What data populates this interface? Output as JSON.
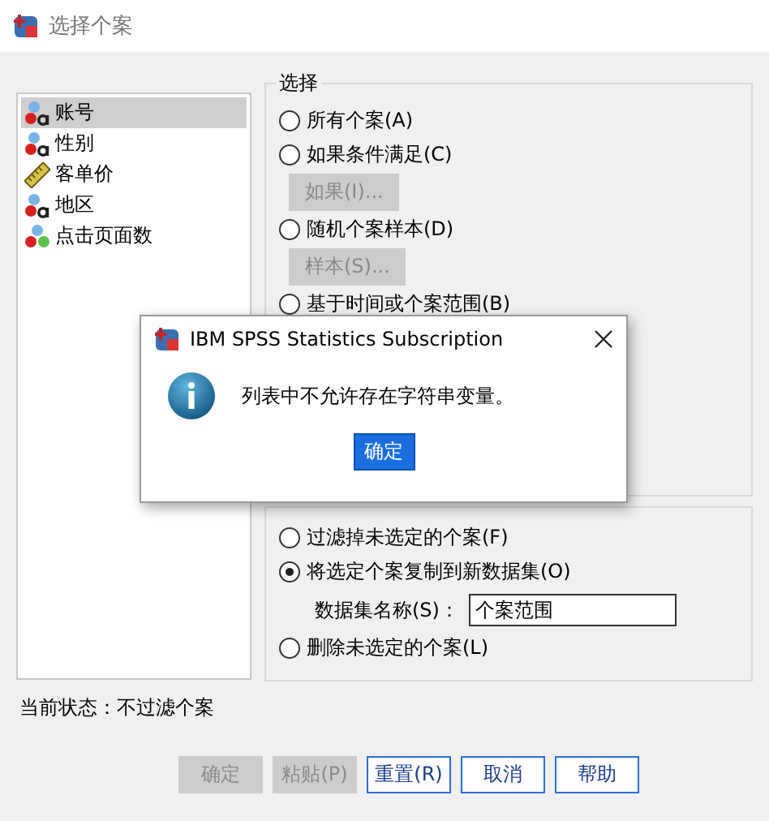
{
  "window": {
    "title": "选择个案"
  },
  "variables": [
    {
      "name": "账号",
      "kind": "string",
      "selected": true
    },
    {
      "name": "性别",
      "kind": "string",
      "selected": false
    },
    {
      "name": "客单价",
      "kind": "scale",
      "selected": false
    },
    {
      "name": "地区",
      "kind": "string",
      "selected": false
    },
    {
      "name": "点击页面数",
      "kind": "nominal",
      "selected": false
    }
  ],
  "select_group": {
    "title": "选择",
    "items": [
      {
        "kind": "radio",
        "label": "所有个案(A)",
        "selected": false
      },
      {
        "kind": "radio",
        "label": "如果条件满足(C)",
        "selected": false
      },
      {
        "kind": "button",
        "label": "如果(I)...",
        "disabled": true
      },
      {
        "kind": "radio",
        "label": "随机个案样本(D)",
        "selected": false
      },
      {
        "kind": "button",
        "label": "样本(S)...",
        "disabled": true
      },
      {
        "kind": "radio",
        "label": "基于时间或个案范围(B)",
        "selected": false
      }
    ]
  },
  "output_group": {
    "items": [
      {
        "kind": "radio",
        "label": "过滤掉未选定的个案(F)",
        "selected": false
      },
      {
        "kind": "radio",
        "label": "将选定个案复制到新数据集(O)",
        "selected": true
      },
      {
        "kind": "field",
        "label": "数据集名称(S)：",
        "value": "个案范围"
      },
      {
        "kind": "radio",
        "label": "删除未选定的个案(L)",
        "selected": false
      }
    ]
  },
  "status": "当前状态：不过滤个案",
  "buttons": [
    {
      "label": "确定",
      "disabled": true
    },
    {
      "label": "粘贴(P)",
      "disabled": true
    },
    {
      "label": "重置(R)",
      "disabled": false
    },
    {
      "label": "取消",
      "disabled": false
    },
    {
      "label": "帮助",
      "disabled": false
    }
  ],
  "message_box": {
    "title": "IBM SPSS Statistics Subscription",
    "message": "列表中不允许存在字符串变量。",
    "button": "确定"
  }
}
